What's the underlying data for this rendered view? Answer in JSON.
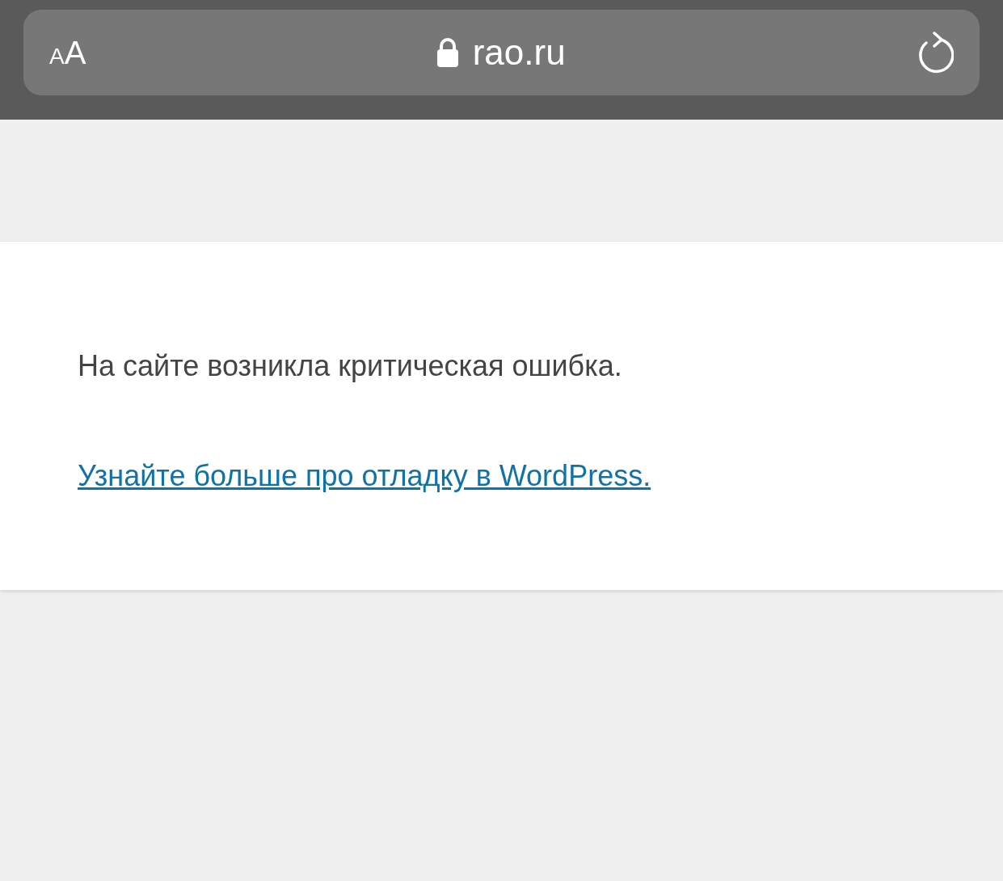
{
  "browser_bar": {
    "text_size_button": "AA",
    "url": "rao.ru"
  },
  "error_page": {
    "message": "На сайте возникла критическая ошибка.",
    "link": "Узнайте больше про отладку в WordPress."
  }
}
